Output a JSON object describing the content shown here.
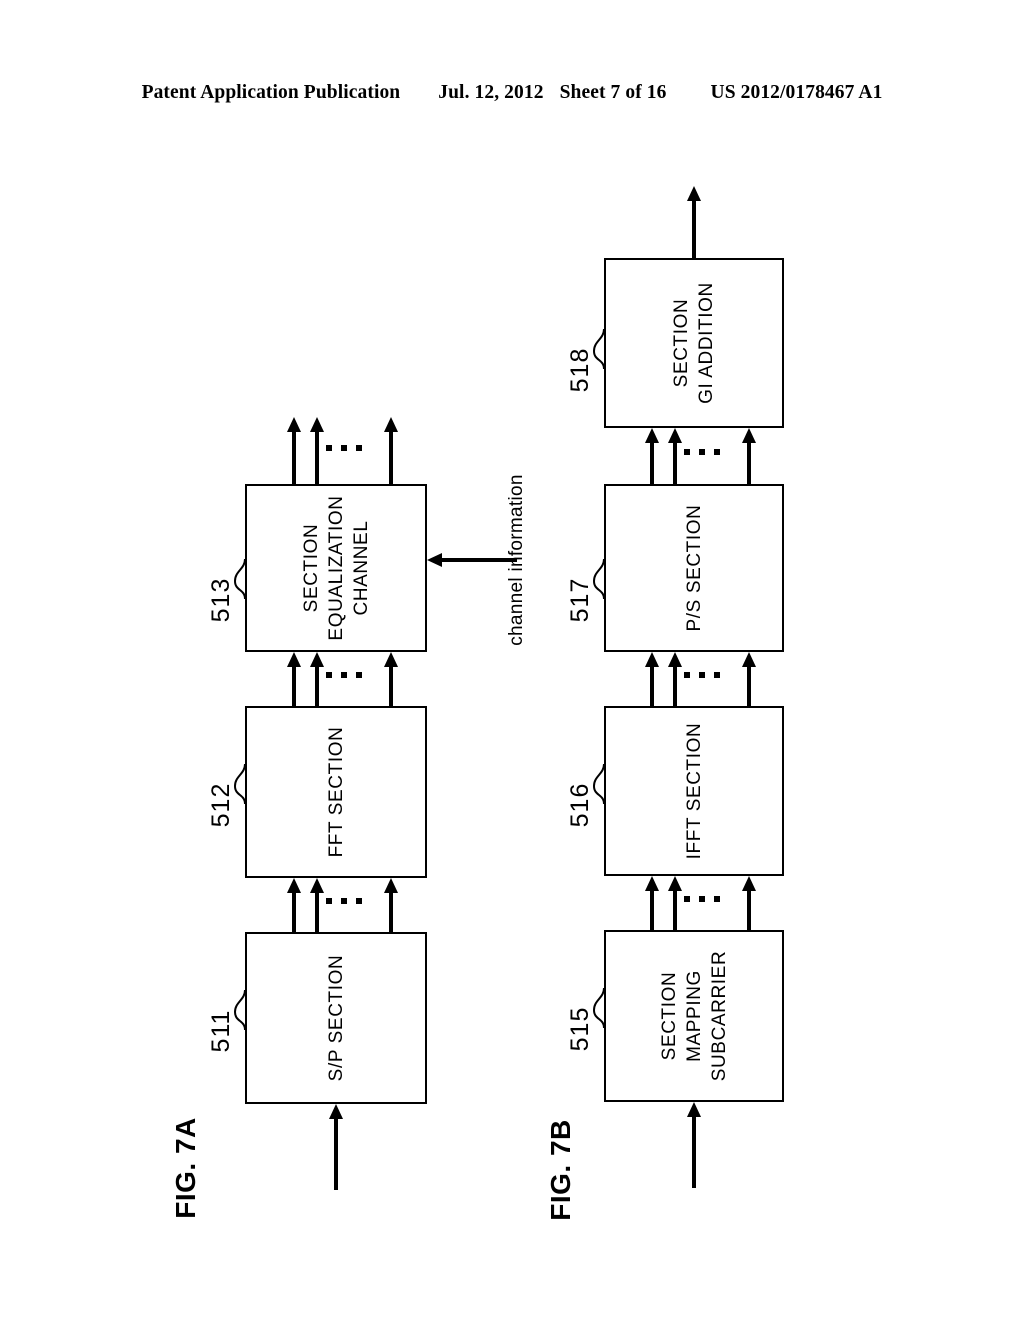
{
  "header": {
    "publication": "Patent Application Publication",
    "date": "Jul. 12, 2012",
    "sheet": "Sheet 7 of 16",
    "document_number": "US 2012/0178467 A1"
  },
  "figures": [
    {
      "caption": "FIG. 7A",
      "blocks": [
        {
          "ref": "511",
          "lines": [
            "S/P SECTION"
          ]
        },
        {
          "ref": "512",
          "lines": [
            "FFT SECTION"
          ]
        },
        {
          "ref": "513",
          "lines": [
            "CHANNEL",
            "EQUALIZATION",
            "SECTION"
          ]
        }
      ],
      "annotations": [
        {
          "text": "channel information"
        }
      ]
    },
    {
      "caption": "FIG. 7B",
      "blocks": [
        {
          "ref": "515",
          "lines": [
            "SUBCARRIER",
            "MAPPING",
            "SECTION"
          ]
        },
        {
          "ref": "516",
          "lines": [
            "IFFT SECTION"
          ]
        },
        {
          "ref": "517",
          "lines": [
            "P/S SECTION"
          ]
        },
        {
          "ref": "518",
          "lines": [
            "GI ADDITION",
            "SECTION"
          ]
        }
      ],
      "annotations": []
    }
  ],
  "colors": {
    "ink": "#000000",
    "paper": "#ffffff"
  }
}
